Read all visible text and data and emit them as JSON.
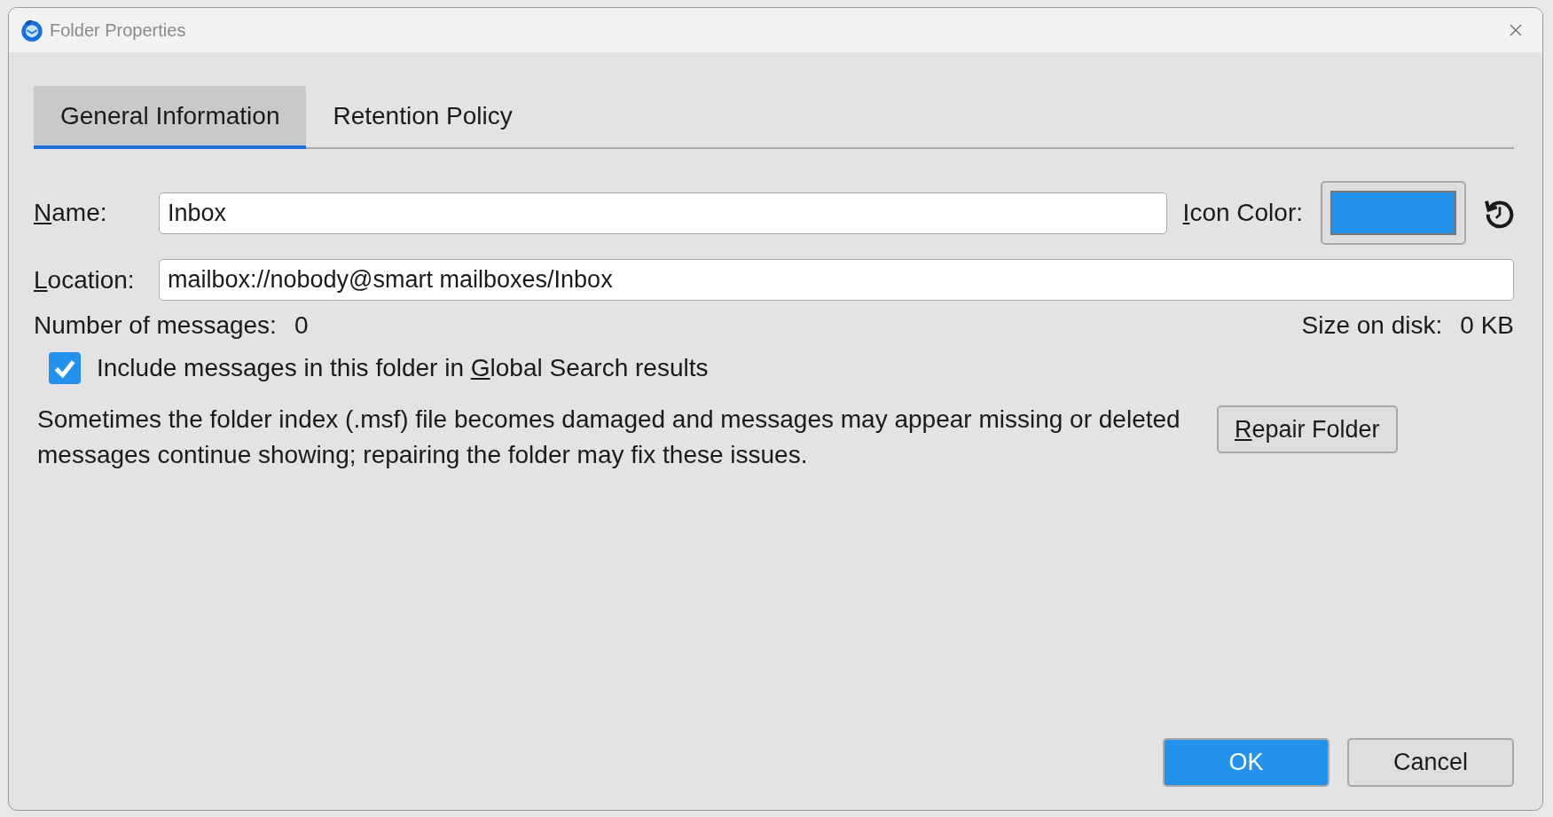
{
  "window": {
    "title": "Folder Properties"
  },
  "tabs": [
    {
      "label": "General Information",
      "selected": true
    },
    {
      "label": "Retention Policy",
      "selected": false
    }
  ],
  "name_field": {
    "label": {
      "key": "N",
      "after": "ame:"
    },
    "value": "Inbox"
  },
  "icon_color": {
    "label": {
      "key": "I",
      "after": "con Color:"
    },
    "color": "#2492eb"
  },
  "location_field": {
    "label": {
      "key": "L",
      "after": "ocation:"
    },
    "value": "mailbox://nobody@smart mailboxes/Inbox"
  },
  "message_count": {
    "label": "Number of messages:",
    "value": "0"
  },
  "size_on_disk": {
    "label": "Size on disk:",
    "value": "0 KB"
  },
  "global_search": {
    "label": {
      "before": "Include messages in this folder in ",
      "key": "G",
      "after": "lobal Search results"
    },
    "checked": true
  },
  "repair": {
    "description": "Sometimes the folder index (.msf) file becomes damaged and messages may appear missing or deleted messages continue showing; repairing the folder may fix these issues.",
    "button": {
      "key": "R",
      "after": "epair Folder"
    }
  },
  "buttons": [
    {
      "label": "OK",
      "kind": "primary"
    },
    {
      "label": "Cancel",
      "kind": "secondary"
    }
  ]
}
